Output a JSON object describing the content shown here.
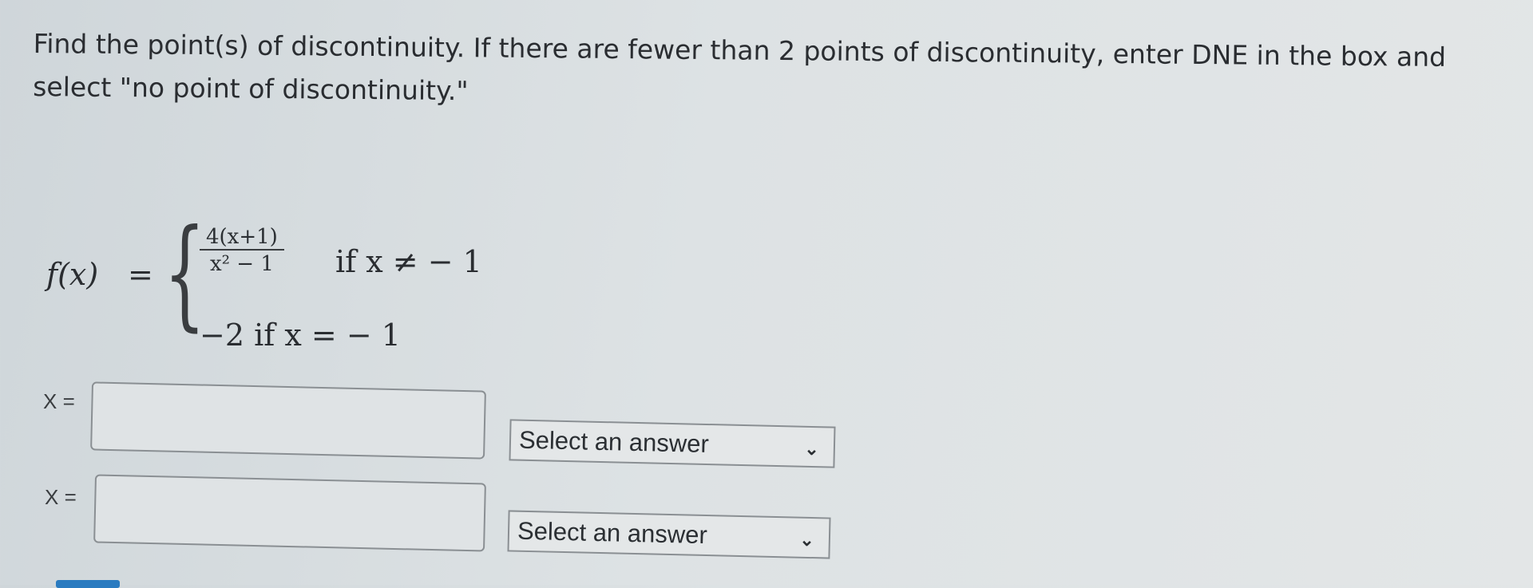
{
  "question": {
    "prompt": "Find the point(s) of discontinuity. If there are fewer than 2 points of discontinuity, enter DNE in the box and select \"no point of discontinuity.\""
  },
  "function": {
    "lhs": "f(x)",
    "equals": "=",
    "brace": "{",
    "case1": {
      "numerator": "4(x+1)",
      "denominator": "x² − 1",
      "condition": "if  x ≠ − 1"
    },
    "case2": {
      "value_condition": "−2  if  x = − 1"
    }
  },
  "answers": [
    {
      "label": "X =",
      "value": "",
      "select": "Select an answer"
    },
    {
      "label": "X =",
      "value": "",
      "select": "Select an answer"
    }
  ],
  "icons": {
    "dropdown": "chevron-down-icon"
  },
  "colors": {
    "background": "#dde2e4",
    "button": "#2a7bc0"
  }
}
